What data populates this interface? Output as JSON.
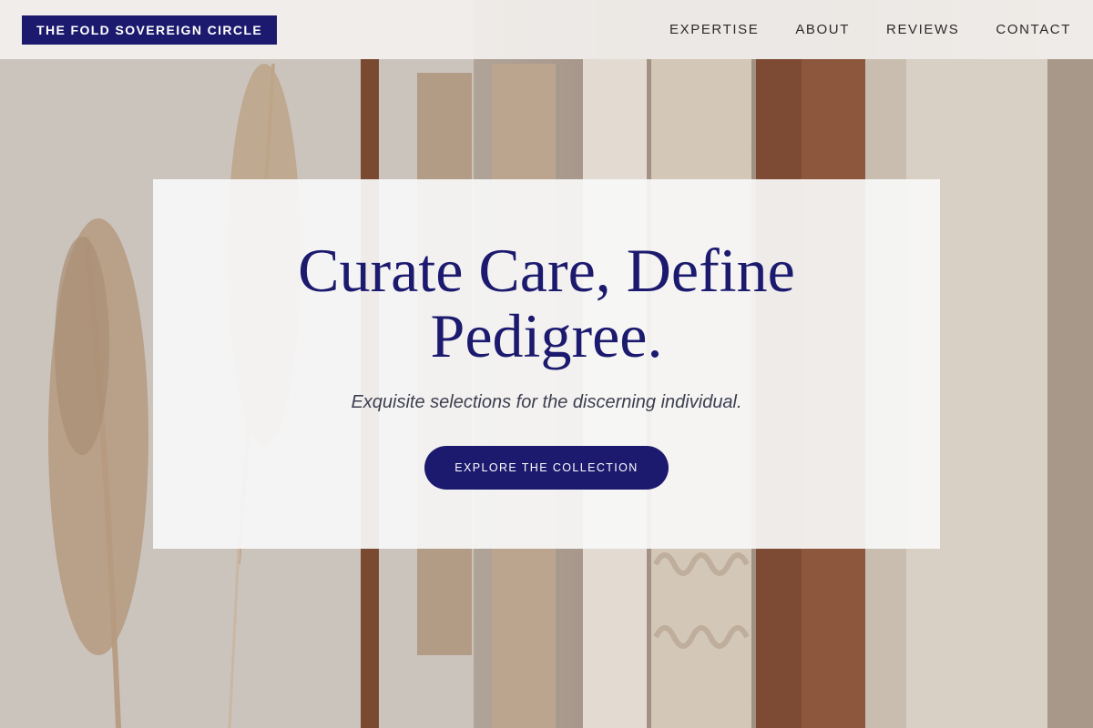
{
  "header": {
    "brand": "THE FOLD SOVEREIGN CIRCLE",
    "nav": [
      "EXPERTISE",
      "ABOUT",
      "REVIEWS",
      "CONTACT"
    ]
  },
  "hero": {
    "title": "Curate Care, Define Pedigree.",
    "subtitle": "Exquisite selections for the discerning individual.",
    "cta_label": "EXPLORE THE COLLECTION"
  },
  "colors": {
    "brand_navy": "#1c1a6e",
    "header_bg": "#f4f2f0",
    "card_bg": "#f8f7f7"
  }
}
